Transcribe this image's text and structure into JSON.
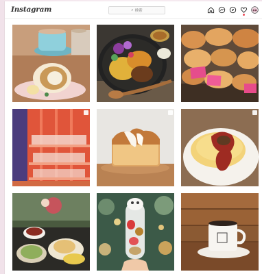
{
  "app": {
    "logo_text": "Instagram"
  },
  "search": {
    "placeholder": "検索",
    "icon": "search-icon"
  },
  "nav": {
    "icons": [
      "home-icon",
      "messenger-icon",
      "explore-icon",
      "heart-icon",
      "avatar"
    ],
    "notification_color": "#ed4956"
  },
  "posts": [
    {
      "subject": "cafe-latte-and-roll-cake",
      "multi": false
    },
    {
      "subject": "curry-plate",
      "multi": false
    },
    {
      "subject": "bakery-breads",
      "multi": false
    },
    {
      "subject": "red-wall-shelves",
      "multi": true
    },
    {
      "subject": "shokupan-toast",
      "multi": true
    },
    {
      "subject": "omurice",
      "multi": true
    },
    {
      "subject": "tea-and-wagashi",
      "multi": false
    },
    {
      "subject": "christmas-parfait",
      "multi": false
    },
    {
      "subject": "coffee-cup-on-wood",
      "multi": false
    }
  ]
}
